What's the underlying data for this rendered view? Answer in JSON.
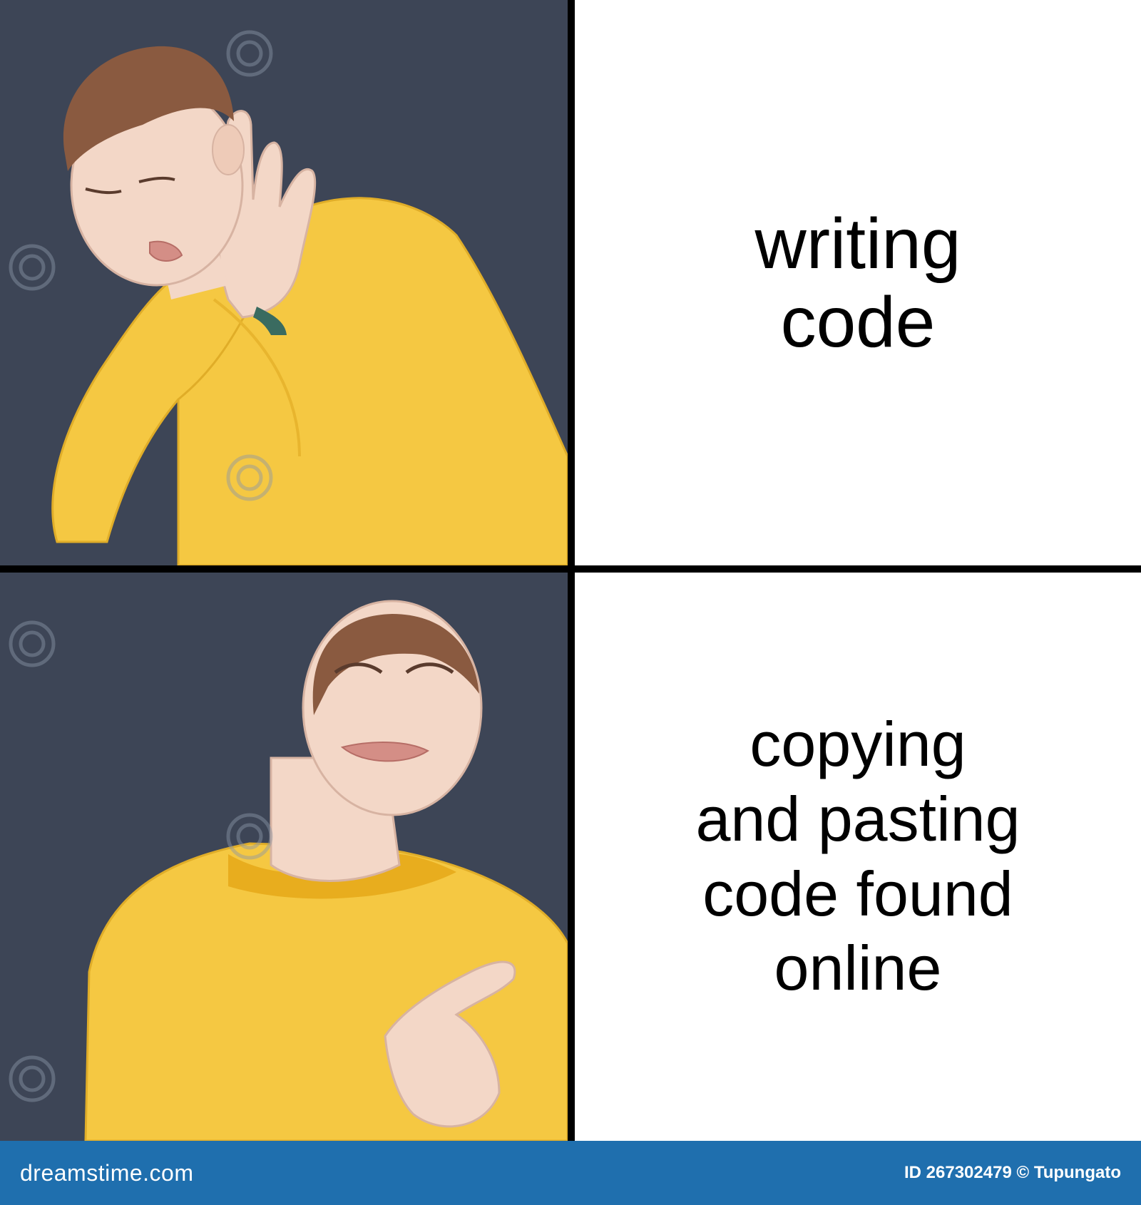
{
  "panels": {
    "reject_caption": "writing\ncode",
    "approve_caption": "copying\nand pasting\ncode found\nonline"
  },
  "footer": {
    "brand": "dreamstime.com",
    "credit": "ID 267302479 © Tupungato"
  },
  "colors": {
    "panel_bg": "#3d4556",
    "sweater": "#f5c842",
    "skin": "#f3d7c7",
    "hair": "#8a5a40",
    "footer_bg": "#1f6fae"
  },
  "icons": [
    "dreamstime-swirl-icon"
  ]
}
